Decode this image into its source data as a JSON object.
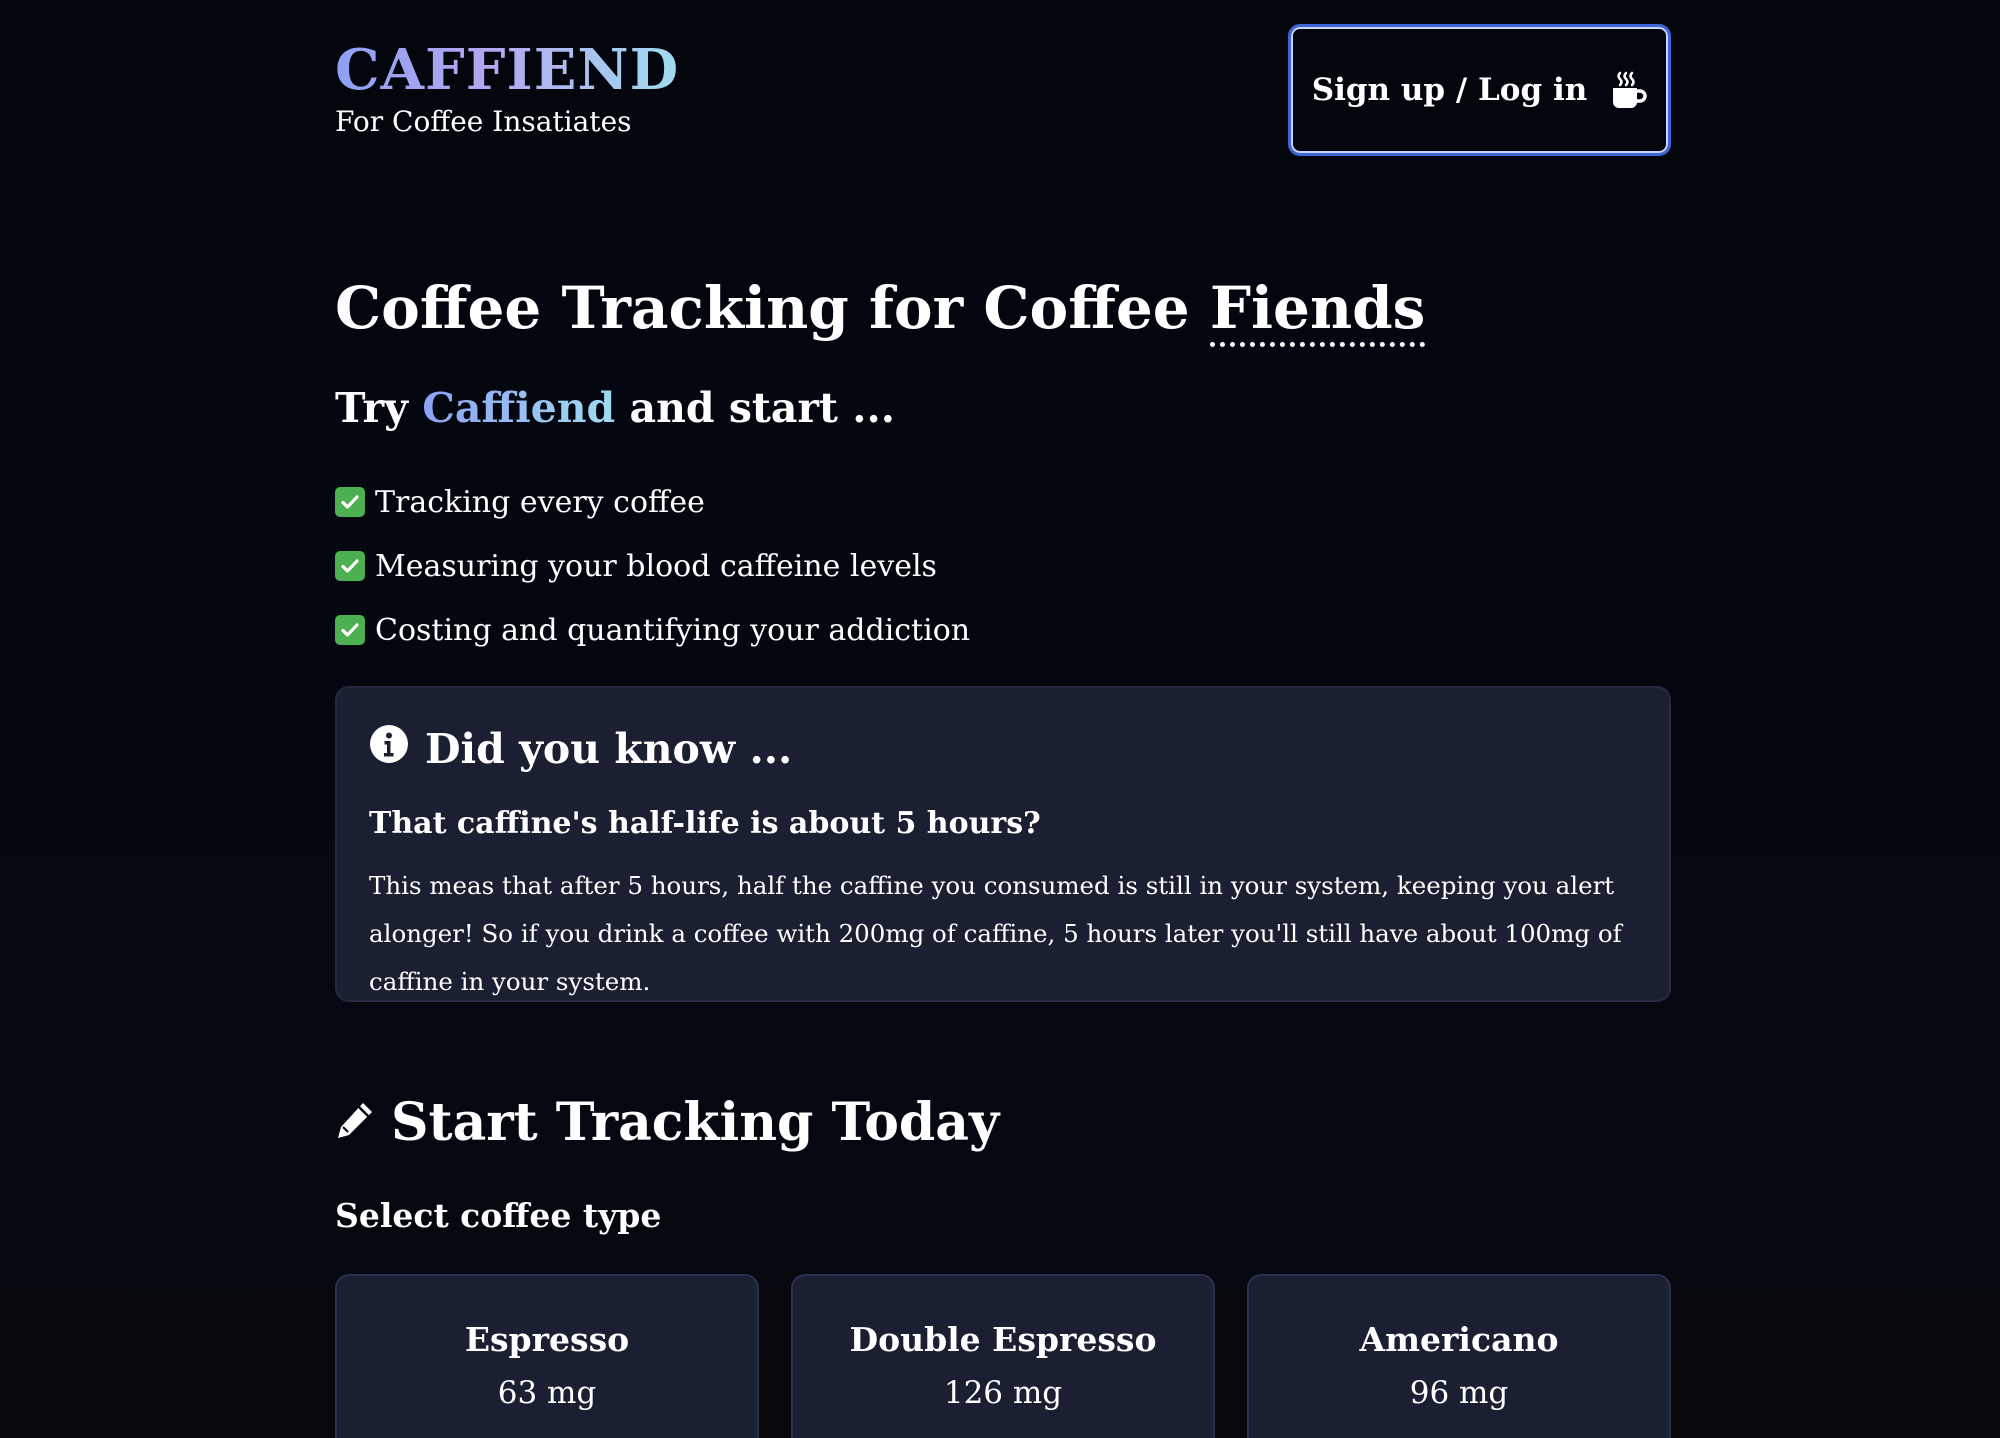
{
  "header": {
    "brand": "CAFFIEND",
    "tagline": "For Coffee Insatiates",
    "auth_button": "Sign up / Log in",
    "auth_icon": "mug-hot-icon"
  },
  "hero": {
    "title_prefix": "Coffee Tracking for Coffee ",
    "title_emphasis": "Fiends",
    "subtitle_before": "Try ",
    "subtitle_accent": "Caffiend",
    "subtitle_after": " and start ...",
    "features": [
      "Tracking every coffee",
      "Measuring your blood caffeine levels",
      "Costing and quantifying your addiction"
    ]
  },
  "info": {
    "heading": "Did you know ...",
    "icon": "info-circle-icon",
    "question": "That caffine's half-life is about 5 hours?",
    "body": "This meas that after 5 hours, half the caffine you consumed is still in your system, keeping you alert alonger! So if you drink a coffee with 200mg of caffine, 5 hours later you'll still have about 100mg of caffine in your system."
  },
  "tracking": {
    "heading": "Start Tracking Today",
    "icon": "pencil-icon",
    "select_label": "Select coffee type",
    "coffees": [
      {
        "name": "Espresso",
        "caffeine": "63 mg"
      },
      {
        "name": "Double Espresso",
        "caffeine": "126 mg"
      },
      {
        "name": "Americano",
        "caffeine": "96 mg"
      }
    ]
  },
  "colors": {
    "background": "#04060d",
    "card": "#1b1f32",
    "accent_start": "#8ea0f4",
    "accent_end": "#9fdcef",
    "button_border": "#3e66d8",
    "check_green": "#4caf50"
  }
}
